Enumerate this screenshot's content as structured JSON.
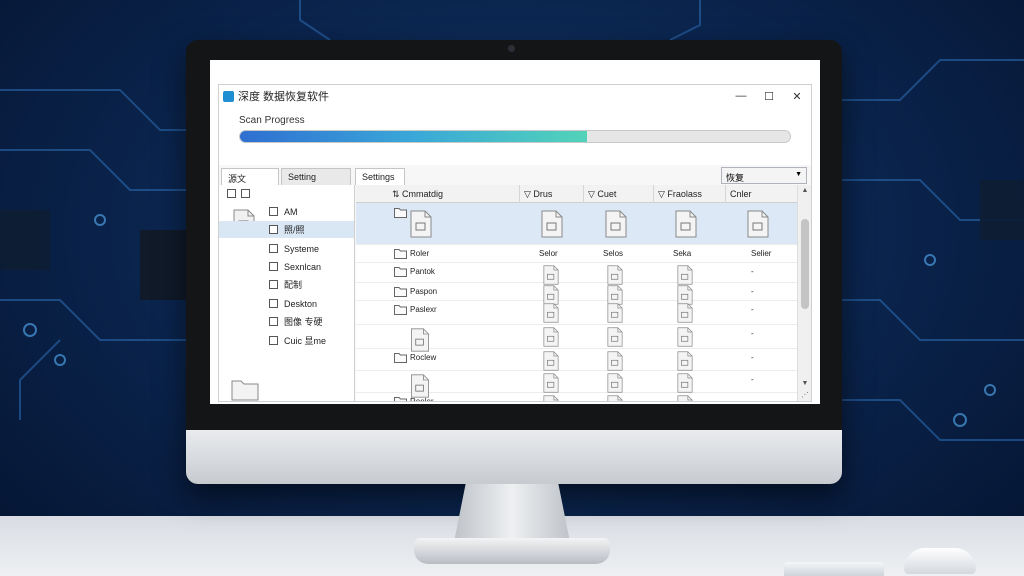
{
  "window": {
    "title": "深度 数据恢复软件",
    "minimize": "—",
    "maximize": "☐",
    "close": "✕"
  },
  "scan": {
    "label": "Scan Progress",
    "progress": 0.63
  },
  "tabs": [
    "源文",
    "Setting",
    "Settings"
  ],
  "combo": {
    "value": "恢复"
  },
  "sidebar": {
    "items": [
      "AM",
      "照/照",
      "Systeme",
      "Sexnlcan",
      "配制",
      "Deskton",
      "图像 专硬",
      "Cuic 显me"
    ]
  },
  "columns": [
    "Cmmatdig",
    "Drus",
    "Cuet",
    "Fraolass",
    "Cnler"
  ],
  "rows": [
    {
      "name": "",
      "c1": "",
      "c2": "",
      "c3": "",
      "c4": ""
    },
    {
      "name": "Roler",
      "c1": "Selor",
      "c2": "Selos",
      "c3": "Seka",
      "c4": "Selier"
    },
    {
      "name": "Pantok",
      "c1": "",
      "c2": "",
      "c3": "",
      "c4": "-"
    },
    {
      "name": "Paspon",
      "c1": "",
      "c2": "",
      "c3": "",
      "c4": "-"
    },
    {
      "name": "Paslexr",
      "c1": "",
      "c2": "",
      "c3": "",
      "c4": "-"
    },
    {
      "name": "",
      "c1": "",
      "c2": "",
      "c3": "",
      "c4": "-"
    },
    {
      "name": "Roclew",
      "c1": "",
      "c2": "",
      "c3": "",
      "c4": "-"
    },
    {
      "name": "",
      "c1": "",
      "c2": "",
      "c3": "",
      "c4": "-"
    },
    {
      "name": "Roeler",
      "c1": "",
      "c2": "",
      "c3": "",
      "c4": ""
    }
  ],
  "colors": {
    "progress_start": "#2f6fd1",
    "progress_end": "#52d3b9",
    "selection": "#dce8f6"
  }
}
